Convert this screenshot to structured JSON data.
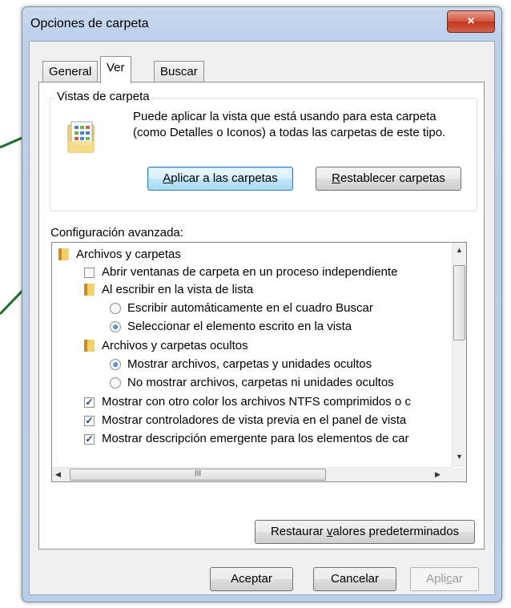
{
  "window": {
    "title": "Opciones de carpeta",
    "close_glyph": "×"
  },
  "tabs": [
    {
      "label": "General",
      "active": false
    },
    {
      "label": "Ver",
      "active": true
    },
    {
      "label": "Buscar",
      "active": false
    }
  ],
  "folder_views": {
    "group_label": "Vistas de carpeta",
    "description": "Puede aplicar la vista que está usando para esta carpeta (como Detalles o Iconos) a todas las carpetas de este tipo.",
    "apply_button": {
      "prefix": "",
      "accel": "A",
      "rest": "plicar a las carpetas"
    },
    "reset_button": {
      "prefix": "",
      "accel": "R",
      "rest": "establecer carpetas"
    },
    "icon": "folder-view-icon"
  },
  "advanced": {
    "label": "Configuración avanzada:",
    "items": [
      {
        "kind": "folder",
        "text": "Archivos y carpetas"
      },
      {
        "kind": "checkbox",
        "checked": false,
        "text": "Abrir ventanas de carpeta  en un proceso independiente"
      },
      {
        "kind": "folder",
        "text": "Al escribir en la vista de lista"
      },
      {
        "kind": "radio",
        "selected": false,
        "text": "Escribir automáticamente en el cuadro Buscar"
      },
      {
        "kind": "radio",
        "selected": true,
        "text": "Seleccionar el elemento escrito en la vista"
      },
      {
        "kind": "folder",
        "text": "Archivos y carpetas ocultos"
      },
      {
        "kind": "radio",
        "selected": true,
        "text": "Mostrar archivos, carpetas y unidades ocultos"
      },
      {
        "kind": "radio",
        "selected": false,
        "text": "No mostrar archivos, carpetas ni unidades ocultos"
      },
      {
        "kind": "checkbox",
        "checked": true,
        "text": "Mostrar con otro color los archivos NTFS comprimidos o c"
      },
      {
        "kind": "checkbox",
        "checked": true,
        "text": "Mostrar controladores de vista previa en el panel de vista"
      },
      {
        "kind": "checkbox",
        "checked": true,
        "text": "Mostrar descripción emergente para los elementos de car"
      }
    ],
    "hscroll_grip": "III",
    "restore_button": {
      "prefix": "Restaurar ",
      "accel": "v",
      "rest": "alores predeterminados"
    }
  },
  "footer": {
    "ok": "Aceptar",
    "cancel": "Cancelar",
    "apply": {
      "prefix": "Apli",
      "accel": "c",
      "rest": "ar",
      "enabled": false
    }
  },
  "colors": {
    "callout_line": "#1e6b2a",
    "title_bar": "#bdd0ea",
    "close_button": "#c9442a"
  }
}
